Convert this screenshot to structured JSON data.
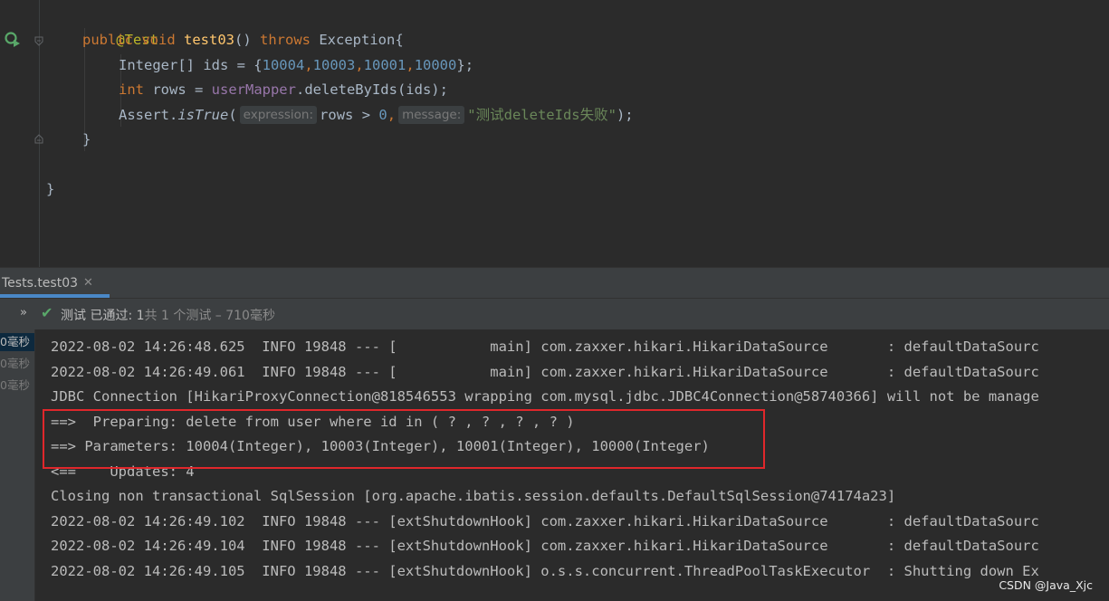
{
  "editor": {
    "annotation": "@Test",
    "method": {
      "public": "public",
      "void": "void",
      "name": "test03",
      "parens": "() ",
      "throws": "throws",
      "exception": " Exception{"
    },
    "ids_line": {
      "decl": "Integer[] ids = {",
      "v1": "10004",
      "v2": "10003",
      "v3": "10001",
      "v4": "10000",
      "end": "};"
    },
    "rows_line": {
      "type": "int",
      "decl": " rows = ",
      "field": "userMapper",
      "call": ".deleteByIds(ids);"
    },
    "assert_line": {
      "cls": "Assert.",
      "method": "isTrue",
      "open": "(",
      "hint_expression": "expression:",
      "cond_a": "rows > ",
      "zero": "0",
      "comma": ",",
      "hint_message": "message:",
      "str": "\"测试deleteIds失败\"",
      "close": ");"
    },
    "method_close": "}",
    "class_close": "}"
  },
  "tabbar": {
    "tab_label": "Tests.test03",
    "close_glyph": "✕"
  },
  "status": {
    "expand_glyph": "»",
    "check_glyph": "✔",
    "label": "测试 已通过: 1",
    "detail": "共 1 个测试 – 710毫秒"
  },
  "durations": [
    "0毫秒",
    "0毫秒",
    "0毫秒"
  ],
  "console_lines": [
    "2022-08-02 14:26:48.625  INFO 19848 --- [           main] com.zaxxer.hikari.HikariDataSource       : defaultDataSourc",
    "2022-08-02 14:26:49.061  INFO 19848 --- [           main] com.zaxxer.hikari.HikariDataSource       : defaultDataSourc",
    "JDBC Connection [HikariProxyConnection@818546553 wrapping com.mysql.jdbc.JDBC4Connection@58740366] will not be manage",
    "==>  Preparing: delete from user where id in ( ? , ? , ? , ? )",
    "==> Parameters: 10004(Integer), 10003(Integer), 10001(Integer), 10000(Integer)",
    "<==    Updates: 4",
    "Closing non transactional SqlSession [org.apache.ibatis.session.defaults.DefaultSqlSession@74174a23]",
    "2022-08-02 14:26:49.102  INFO 19848 --- [extShutdownHook] com.zaxxer.hikari.HikariDataSource       : defaultDataSourc",
    "2022-08-02 14:26:49.104  INFO 19848 --- [extShutdownHook] com.zaxxer.hikari.HikariDataSource       : defaultDataSourc",
    "2022-08-02 14:26:49.105  INFO 19848 --- [extShutdownHook] o.s.s.concurrent.ThreadPoolTaskExecutor  : Shutting down Ex"
  ],
  "watermark": "CSDN @Java_Xjc",
  "colors": {
    "keyword": "#cc7832",
    "annotation": "#bbb529",
    "method": "#ffc66d",
    "number": "#6897bb",
    "string": "#6a8759",
    "field": "#9876aa",
    "pass": "#59a869",
    "highlight_box": "#e0272b"
  },
  "icons": [
    "run-test-icon",
    "fold-icon",
    "checkmark-icon",
    "close-icon",
    "expand-icon"
  ]
}
